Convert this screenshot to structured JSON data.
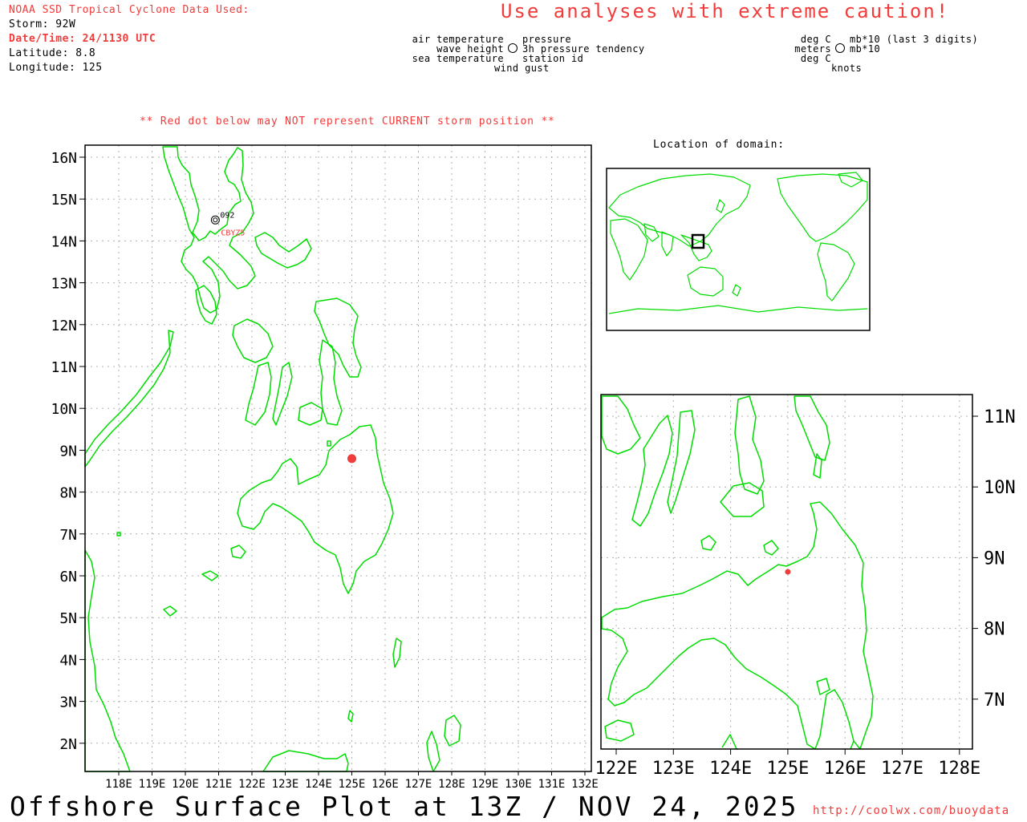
{
  "header": {
    "source_title": "NOAA SSD Tropical Cyclone Data Used:",
    "storm": "Storm: 92W",
    "datetime": "Date/Time: 24/1130 UTC",
    "latitude": "Latitude: 8.8",
    "longitude": "Longitude: 125",
    "caution": "Use analyses with extreme caution!"
  },
  "station_legend": {
    "left": [
      "air temperature",
      "wave height",
      "sea temperature"
    ],
    "right": [
      "pressure",
      "3h pressure tendency",
      "station id"
    ],
    "bottom": "wind gust",
    "units_left": [
      "deg C",
      "meters",
      "deg C"
    ],
    "units_right": [
      "mb*10 (last 3 digits)",
      "mb*10"
    ],
    "units_bottom": "knots"
  },
  "storm_note": "** Red dot below may NOT represent CURRENT storm position **",
  "main_map": {
    "lat_labels": [
      "16N",
      "15N",
      "14N",
      "13N",
      "12N",
      "11N",
      "10N",
      "9N",
      "8N",
      "7N",
      "6N",
      "5N",
      "4N",
      "3N",
      "2N"
    ],
    "lon_labels": [
      "118E",
      "119E",
      "120E",
      "121E",
      "122E",
      "123E",
      "124E",
      "125E",
      "126E",
      "127E",
      "128E",
      "129E",
      "130E",
      "131E",
      "132E"
    ],
    "station": {
      "pressure": "092",
      "id": "CBYZ5",
      "lat": 14.5,
      "lon": 120.9
    },
    "storm_position": {
      "lat": 8.8,
      "lon": 125.0
    }
  },
  "locator": {
    "title": "Location of domain:"
  },
  "zoom_map": {
    "lat_labels": [
      "11N",
      "10N",
      "9N",
      "8N",
      "7N"
    ],
    "lon_labels": [
      "122E",
      "123E",
      "124E",
      "125E",
      "126E",
      "127E",
      "128E"
    ]
  },
  "footer": {
    "title": "Offshore Surface Plot at 13Z / NOV 24, 2025",
    "url": "http://coolwx.com/buoydata"
  },
  "colors": {
    "coastline": "#00dc00",
    "storm_dot": "#f03c3c",
    "text_red": "#f03c3c"
  }
}
